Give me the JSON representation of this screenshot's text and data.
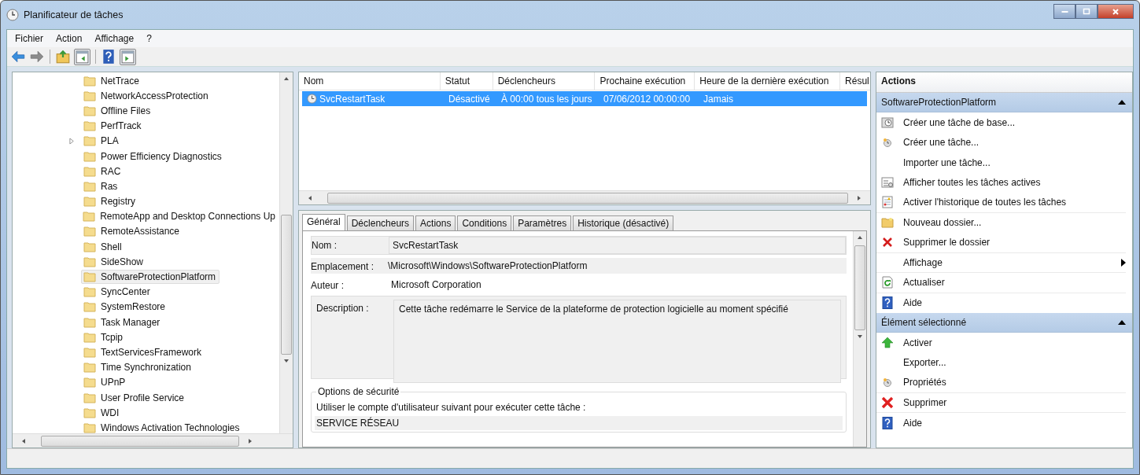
{
  "window": {
    "title": "Planificateur de tâches"
  },
  "menu": [
    {
      "label": "Fichier"
    },
    {
      "label": "Action"
    },
    {
      "label": "Affichage"
    },
    {
      "label": "?"
    }
  ],
  "toolbar": [
    {
      "kind": "back"
    },
    {
      "kind": "forward"
    },
    {
      "kind": "sep"
    },
    {
      "kind": "up-folder"
    },
    {
      "kind": "pane-left"
    },
    {
      "kind": "sep"
    },
    {
      "kind": "help"
    },
    {
      "kind": "pane-right"
    }
  ],
  "tree": {
    "items": [
      {
        "label": "NetTrace",
        "expandable": false,
        "selected": false
      },
      {
        "label": "NetworkAccessProtection",
        "expandable": false,
        "selected": false
      },
      {
        "label": "Offline Files",
        "expandable": false,
        "selected": false
      },
      {
        "label": "PerfTrack",
        "expandable": false,
        "selected": false
      },
      {
        "label": "PLA",
        "expandable": true,
        "selected": false
      },
      {
        "label": "Power Efficiency Diagnostics",
        "expandable": false,
        "selected": false
      },
      {
        "label": "RAC",
        "expandable": false,
        "selected": false
      },
      {
        "label": "Ras",
        "expandable": false,
        "selected": false
      },
      {
        "label": "Registry",
        "expandable": false,
        "selected": false
      },
      {
        "label": "RemoteApp and Desktop Connections Up",
        "expandable": false,
        "selected": false
      },
      {
        "label": "RemoteAssistance",
        "expandable": false,
        "selected": false
      },
      {
        "label": "Shell",
        "expandable": false,
        "selected": false
      },
      {
        "label": "SideShow",
        "expandable": false,
        "selected": false
      },
      {
        "label": "SoftwareProtectionPlatform",
        "expandable": false,
        "selected": true
      },
      {
        "label": "SyncCenter",
        "expandable": false,
        "selected": false
      },
      {
        "label": "SystemRestore",
        "expandable": false,
        "selected": false
      },
      {
        "label": "Task Manager",
        "expandable": false,
        "selected": false
      },
      {
        "label": "Tcpip",
        "expandable": false,
        "selected": false
      },
      {
        "label": "TextServicesFramework",
        "expandable": false,
        "selected": false
      },
      {
        "label": "Time Synchronization",
        "expandable": false,
        "selected": false
      },
      {
        "label": "UPnP",
        "expandable": false,
        "selected": false
      },
      {
        "label": "User Profile Service",
        "expandable": false,
        "selected": false
      },
      {
        "label": "WDI",
        "expandable": false,
        "selected": false
      },
      {
        "label": "Windows Activation Technologies",
        "expandable": false,
        "selected": false
      }
    ]
  },
  "table": {
    "columns": [
      "Nom",
      "Statut",
      "Déclencheurs",
      "Prochaine exécution",
      "Heure de la dernière exécution",
      "Résul"
    ],
    "rows": [
      {
        "cells": [
          "SvcRestartTask",
          "Désactivé",
          "À 00:00 tous les jours",
          "07/06/2012 00:00:00",
          "Jamais"
        ],
        "selected": true
      }
    ]
  },
  "details": {
    "tabs": [
      {
        "label": "Général",
        "selected": true
      },
      {
        "label": "Déclencheurs",
        "selected": false
      },
      {
        "label": "Actions",
        "selected": false
      },
      {
        "label": "Conditions",
        "selected": false
      },
      {
        "label": "Paramètres",
        "selected": false
      },
      {
        "label": "Historique (désactivé)",
        "selected": false
      }
    ],
    "fields": [
      {
        "label": "Nom :",
        "value": "SvcRestartTask",
        "kind": "box"
      },
      {
        "label": "Emplacement :",
        "value": "\\Microsoft\\Windows\\SoftwareProtectionPlatform",
        "kind": "flat"
      },
      {
        "label": "Auteur :",
        "value": "Microsoft Corporation",
        "kind": "plain"
      },
      {
        "label": "Description :",
        "value": "Cette tâche redémarre le Service de la plateforme de protection logicielle au moment spécifié",
        "kind": "area"
      }
    ],
    "security": {
      "title": "Options de sécurité",
      "label": "Utiliser le compte d'utilisateur suivant pour exécuter cette tâche :",
      "value": "SERVICE RÉSEAU"
    }
  },
  "actions": {
    "title": "Actions",
    "sections": [
      {
        "title": "SoftwareProtectionPlatform",
        "expanded": true,
        "items": [
          {
            "label": "Créer une tâche de base...",
            "kind": "clock-card",
            "submenu": false,
            "divider_after": false
          },
          {
            "label": "Créer une tâche...",
            "kind": "clock",
            "submenu": false,
            "divider_after": false
          },
          {
            "label": "Importer une tâche...",
            "kind": "none",
            "submenu": false,
            "divider_after": false
          },
          {
            "label": "Afficher toutes les tâches actives",
            "kind": "list",
            "submenu": false,
            "divider_after": false
          },
          {
            "label": "Activer l'historique de toutes les tâches",
            "kind": "history",
            "submenu": false,
            "divider_after": true
          },
          {
            "label": "Nouveau dossier...",
            "kind": "folder",
            "submenu": false,
            "divider_after": false
          },
          {
            "label": "Supprimer le dossier",
            "kind": "delete",
            "submenu": false,
            "divider_after": true
          },
          {
            "label": "Affichage",
            "kind": "none",
            "submenu": true,
            "divider_after": true
          },
          {
            "label": "Actualiser",
            "kind": "refresh",
            "submenu": false,
            "divider_after": true
          },
          {
            "label": "Aide",
            "kind": "help",
            "submenu": false,
            "divider_after": false
          }
        ]
      },
      {
        "title": "Élément sélectionné",
        "expanded": true,
        "items": [
          {
            "label": "Activer",
            "kind": "up-arrow",
            "submenu": false,
            "divider_after": false
          },
          {
            "label": "Exporter...",
            "kind": "none",
            "submenu": false,
            "divider_after": false
          },
          {
            "label": "Propriétés",
            "kind": "clock",
            "submenu": false,
            "divider_after": true
          },
          {
            "label": "Supprimer",
            "kind": "delete-big",
            "submenu": false,
            "divider_after": true
          },
          {
            "label": "Aide",
            "kind": "help",
            "submenu": false,
            "divider_after": false
          }
        ]
      }
    ]
  }
}
